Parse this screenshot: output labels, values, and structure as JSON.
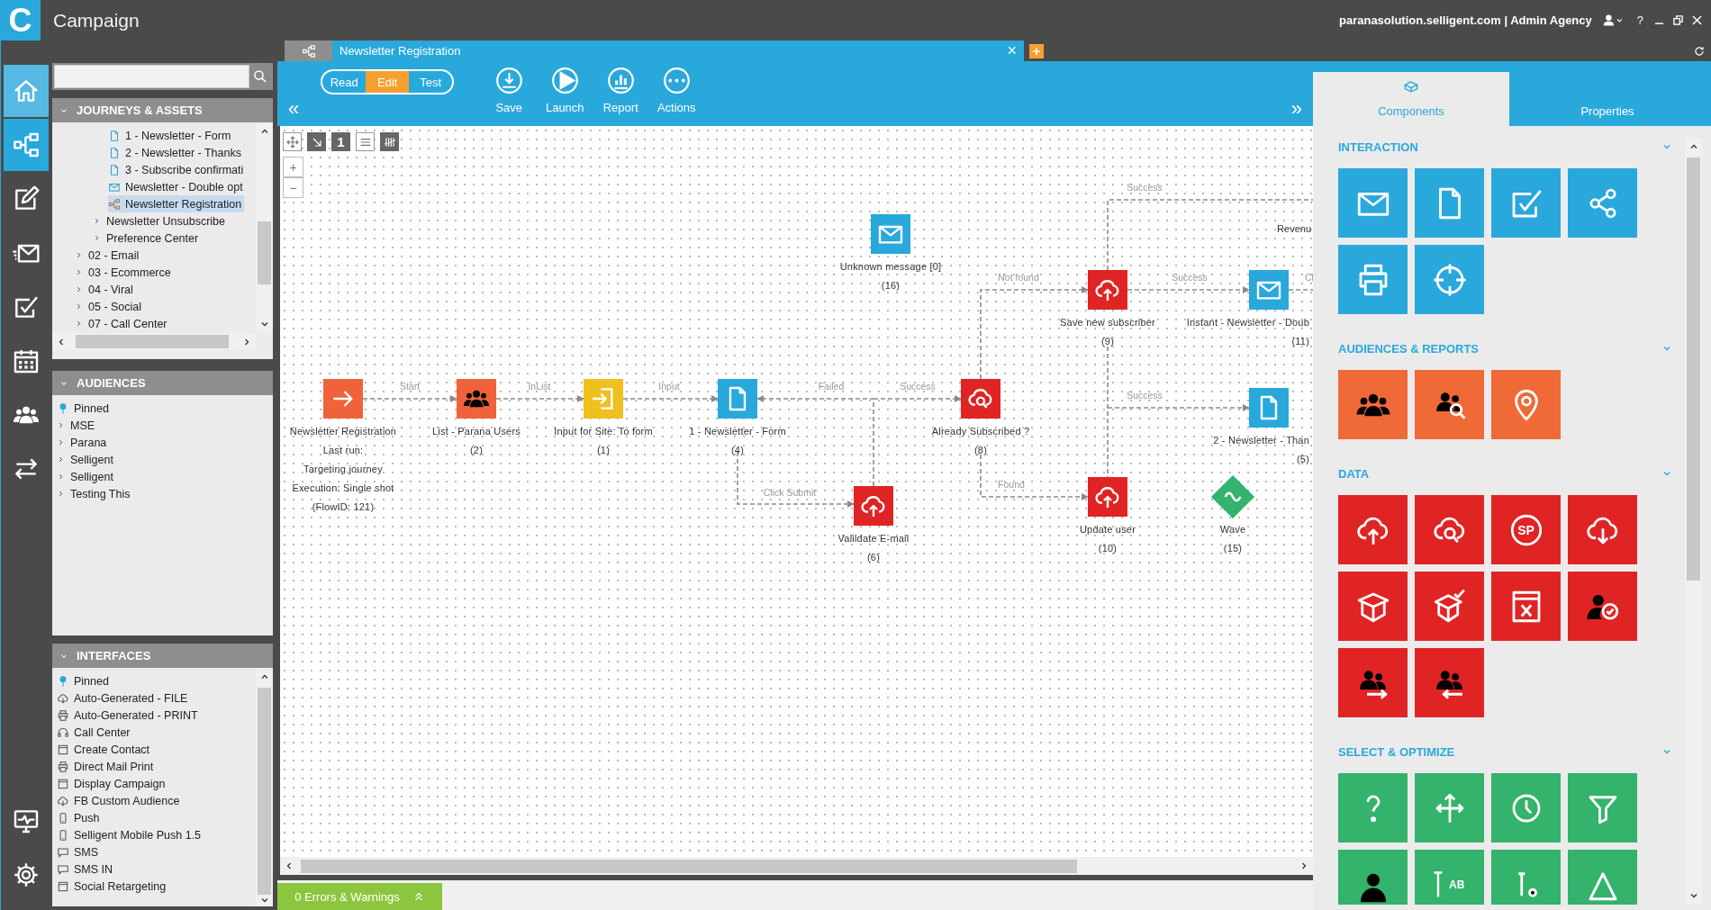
{
  "header": {
    "logo": "C",
    "title": "Campaign",
    "account": "paranasolution.selligent.com | Admin Agency",
    "help": "?"
  },
  "rail": {
    "top": [
      {
        "kind": "home",
        "selected": false,
        "hovered": true
      },
      {
        "kind": "hierarchy",
        "selected": true,
        "hovered": false
      },
      {
        "kind": "pencil",
        "selected": false,
        "hovered": false
      },
      {
        "kind": "mail",
        "selected": false,
        "hovered": false
      },
      {
        "kind": "checkbox",
        "selected": false,
        "hovered": false
      },
      {
        "kind": "calendar",
        "selected": false,
        "hovered": false
      },
      {
        "kind": "people",
        "selected": false,
        "hovered": false
      },
      {
        "kind": "arrows",
        "selected": false,
        "hovered": false
      }
    ],
    "bottom": [
      {
        "kind": "monitor",
        "selected": false,
        "hovered": false
      },
      {
        "kind": "settings",
        "selected": false,
        "hovered": false
      }
    ]
  },
  "journeys": {
    "title": "JOURNEYS & ASSETS",
    "expanded": true,
    "items": [
      {
        "children": [
          {
            "children": [
              {
                "kind": "page",
                "label": "1 - Newsletter - Form",
                "selected": false
              },
              {
                "kind": "page",
                "label": "2 - Newsletter - Thanks",
                "selected": false
              },
              {
                "kind": "page",
                "label": "3 - Subscribe confirmati",
                "selected": false
              },
              {
                "kind": "envelope",
                "label": "Newsletter - Double opt",
                "selected": false
              },
              {
                "kind": "hierarchy",
                "label": "Newsletter Registration",
                "selected": true
              }
            ]
          },
          {
            "kind": "folder",
            "label": "Newsletter Unsubscribe",
            "expanded": false,
            "selected": false
          },
          {
            "kind": "folder",
            "label": "Preference Center",
            "expanded": false,
            "selected": false
          }
        ]
      },
      {
        "kind": "folder",
        "label": "02 - Email",
        "expanded": false,
        "selected": false
      },
      {
        "kind": "folder",
        "label": "03 - Ecommerce",
        "expanded": false,
        "selected": false
      },
      {
        "kind": "folder",
        "label": "04 - Viral",
        "expanded": false,
        "selected": false
      },
      {
        "kind": "folder",
        "label": "05 - Social",
        "expanded": false,
        "selected": false
      },
      {
        "kind": "folder",
        "label": "07 - Call Center",
        "expanded": false,
        "selected": false
      }
    ]
  },
  "audiences": {
    "title": "AUDIENCES",
    "expanded": true,
    "items": [
      {
        "kind": "pin",
        "label": "Pinned"
      },
      {
        "kind": "folder",
        "label": "MSE",
        "expanded": false
      },
      {
        "kind": "folder",
        "label": "Parana",
        "expanded": false
      },
      {
        "kind": "folder",
        "label": "Selligent",
        "expanded": false
      },
      {
        "kind": "folder",
        "label": "Selligent",
        "expanded": false
      },
      {
        "kind": "folder",
        "label": "Testing This",
        "expanded": false
      }
    ]
  },
  "interfaces": {
    "title": "INTERFACES",
    "expanded": true,
    "items": [
      {
        "kind": "pin",
        "label": "Pinned"
      },
      {
        "kind": "download",
        "label": "Auto-Generated - FILE"
      },
      {
        "kind": "printer",
        "label": "Auto-Generated - PRINT"
      },
      {
        "kind": "headset",
        "label": "Call Center"
      },
      {
        "kind": "window",
        "label": "Create Contact"
      },
      {
        "kind": "printer",
        "label": "Direct Mail Print"
      },
      {
        "kind": "window",
        "label": "Display Campaign"
      },
      {
        "kind": "download",
        "label": "FB Custom Audience"
      },
      {
        "kind": "phone",
        "label": "Push"
      },
      {
        "kind": "phone",
        "label": "Selligent Mobile Push 1.5"
      },
      {
        "kind": "chat",
        "label": "SMS"
      },
      {
        "kind": "chat",
        "label": "SMS IN"
      },
      {
        "kind": "window",
        "label": "Social Retargeting"
      }
    ]
  },
  "tabs": [
    {
      "kind": "icon",
      "selected": false
    },
    {
      "kind": "text",
      "label": "Newsletter Registration",
      "selected": true
    }
  ],
  "tab_close": "×",
  "tab_add": "+",
  "modes": [
    {
      "label": "Read",
      "selected": false
    },
    {
      "label": "Edit",
      "selected": true
    },
    {
      "label": "Test",
      "selected": false
    }
  ],
  "actions": [
    {
      "kind": "tray",
      "label": "Save"
    },
    {
      "kind": "play",
      "label": "Launch"
    },
    {
      "kind": "chart",
      "label": "Report"
    },
    {
      "kind": "dots",
      "label": "Actions"
    }
  ],
  "collapse_left": "«",
  "collapse_right": "»",
  "canvas_tools": [
    {
      "kind": "move",
      "on": false
    },
    {
      "kind": "pointer",
      "on": true
    },
    {
      "kind": "number",
      "label": "1",
      "on": true
    },
    {
      "kind": "lines",
      "on": false
    },
    {
      "kind": "tally",
      "on": true
    }
  ],
  "zoom": [
    "+",
    "−"
  ],
  "nodes": [
    {
      "kind": "arrow",
      "color": "#f0633a",
      "lines": [
        "Newsletter Registration",
        "Last run:",
        "Targeting journey",
        "Execution: Single shot",
        "(FlowID: 121)"
      ]
    },
    {
      "kind": "people",
      "color": "#f0633a",
      "lines": [
        "List - Parana Users",
        "(2)"
      ]
    },
    {
      "kind": "enter",
      "color": "#f0c020",
      "lines": [
        "Input for Site: To form",
        "(1)"
      ]
    },
    {
      "kind": "page",
      "color": "#29a8dc",
      "lines": [
        "1 - Newsletter - Form",
        "(4)"
      ]
    },
    {
      "kind": "lookup",
      "color": "#e02424",
      "lines": [
        "Already Subscribed ?",
        "(8)"
      ]
    },
    {
      "kind": "upload",
      "color": "#e02424",
      "lines": [
        "Valildate E-mail",
        "(6)"
      ]
    },
    {
      "kind": "upload",
      "color": "#e02424",
      "lines": [
        "Save new subscriber",
        "(9)"
      ]
    },
    {
      "kind": "envelope",
      "color": "#29a8dc",
      "lines": [
        "Instant - Newsletter - Doub",
        "(11)"
      ]
    },
    {
      "kind": "page",
      "color": "#29a8dc",
      "lines": [
        "2 - Newsletter - Than",
        "(5)"
      ]
    },
    {
      "kind": "upload",
      "color": "#e02424",
      "lines": [
        "Update user",
        "(10)"
      ]
    },
    {
      "kind": "wave",
      "color": "#33b36b",
      "lines": [
        "Wave",
        "(15)"
      ]
    },
    {
      "kind": "envelope",
      "color": "#29a8dc",
      "lines": [
        "Unknown message [0]",
        "(16)"
      ]
    }
  ],
  "connectors": [
    {
      "label": "Start"
    },
    {
      "label": "InList"
    },
    {
      "label": "Input"
    },
    {
      "label": "Failed"
    },
    {
      "label": "Success"
    },
    {
      "label": "Click Submit"
    },
    {
      "label": "Not found"
    },
    {
      "label": "Found"
    },
    {
      "label": "Success"
    },
    {
      "label": "Success"
    },
    {
      "label": "Success"
    },
    {
      "label": "Cl"
    }
  ],
  "canvas_texts": [
    "Revenu"
  ],
  "status": {
    "label": "0 Errors & Warnings"
  },
  "panel_tabs": [
    {
      "label": "Components",
      "selected": true
    },
    {
      "label": "Properties",
      "selected": false
    }
  ],
  "sections": [
    {
      "title": "INTERACTION",
      "expanded": true,
      "color": "#29a8dc",
      "tiles": [
        {
          "kind": "envelope"
        },
        {
          "kind": "page"
        },
        {
          "kind": "checkbox"
        },
        {
          "kind": "share"
        },
        {
          "kind": "printer"
        },
        {
          "kind": "crosshair"
        }
      ]
    },
    {
      "title": "AUDIENCES & REPORTS",
      "expanded": true,
      "color": "#f06a38",
      "tiles": [
        {
          "kind": "people"
        },
        {
          "kind": "peoplesearch"
        },
        {
          "kind": "location"
        }
      ]
    },
    {
      "title": "DATA",
      "expanded": true,
      "color": "#e02424",
      "tiles": [
        {
          "kind": "upload"
        },
        {
          "kind": "lookup"
        },
        {
          "kind": "circle",
          "text": "SP"
        },
        {
          "kind": "download"
        },
        {
          "kind": "box"
        },
        {
          "kind": "boxcheck"
        },
        {
          "kind": "formula"
        },
        {
          "kind": "usercheck"
        },
        {
          "kind": "usersout"
        },
        {
          "kind": "usersin"
        }
      ]
    },
    {
      "title": "SELECT & OPTIMIZE",
      "expanded": true,
      "color": "#33b36b",
      "tiles": [
        {
          "kind": "question"
        },
        {
          "kind": "split"
        },
        {
          "kind": "clock"
        },
        {
          "kind": "funnel"
        },
        {
          "kind": "person"
        },
        {
          "kind": "tube",
          "text": "AB"
        },
        {
          "kind": "flask"
        },
        {
          "kind": "triangle"
        }
      ]
    }
  ]
}
